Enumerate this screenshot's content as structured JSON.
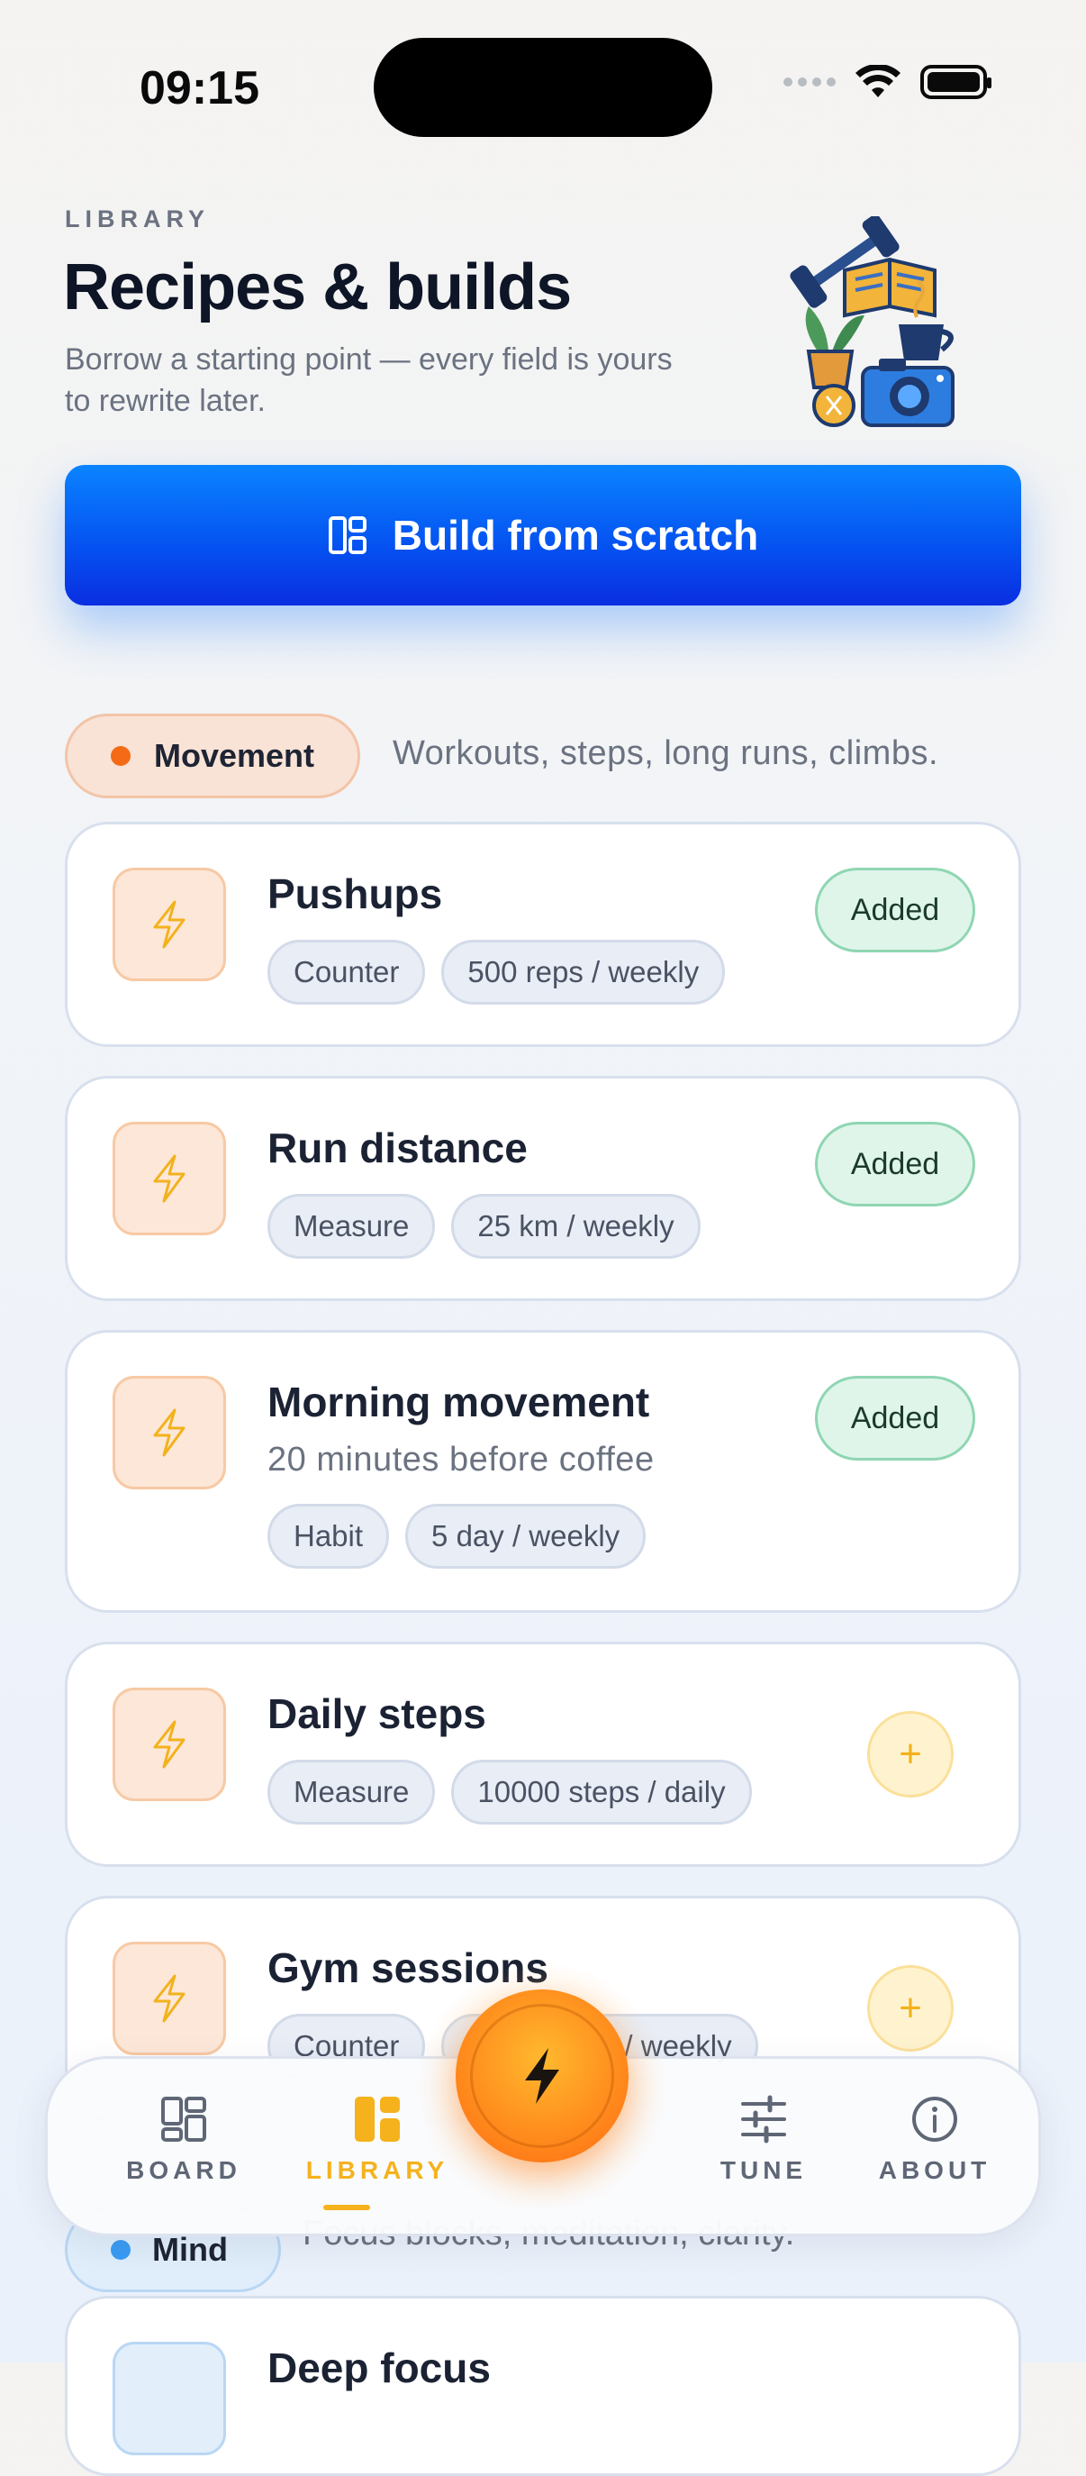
{
  "status": {
    "time": "09:15"
  },
  "header": {
    "eyebrow": "LIBRARY",
    "title": "Recipes & builds",
    "subtitle": "Borrow a starting point — every field is yours to rewrite later.",
    "cta_label": "Build from scratch"
  },
  "category": {
    "name": "Movement",
    "description": "Workouts, steps, long runs, climbs.",
    "color": "#f56a17"
  },
  "cards": [
    {
      "title": "Pushups",
      "subtitle": "",
      "tags": [
        "Counter",
        "500 reps / weekly"
      ],
      "action": "Added"
    },
    {
      "title": "Run distance",
      "subtitle": "",
      "tags": [
        "Measure",
        "25 km / weekly"
      ],
      "action": "Added"
    },
    {
      "title": "Morning movement",
      "subtitle": "20 minutes before coffee",
      "tags": [
        "Habit",
        "5 day / weekly"
      ],
      "action": "Added"
    },
    {
      "title": "Daily steps",
      "subtitle": "",
      "tags": [
        "Measure",
        "10000 steps / daily"
      ],
      "action": "+"
    },
    {
      "title": "Gym sessions",
      "subtitle": "",
      "tags": [
        "Counter",
        "/ weekly"
      ],
      "action": "+"
    }
  ],
  "next_category": {
    "name": "Mind",
    "description": "Focus blocks, meditation, clarity.",
    "color": "#3b9cf3"
  },
  "next_card": {
    "title": "Deep focus"
  },
  "tabs": [
    {
      "label": "BOARD",
      "icon": "board-icon",
      "active": false
    },
    {
      "label": "LIBRARY",
      "icon": "library-icon",
      "active": true
    },
    {
      "label": "TUNE",
      "icon": "tune-icon",
      "active": false
    },
    {
      "label": "ABOUT",
      "icon": "info-icon",
      "active": false
    }
  ],
  "colors": {
    "accent": "#f5b21c",
    "primary_blue": "#0a84ff",
    "added_green": "#dff5ea"
  }
}
